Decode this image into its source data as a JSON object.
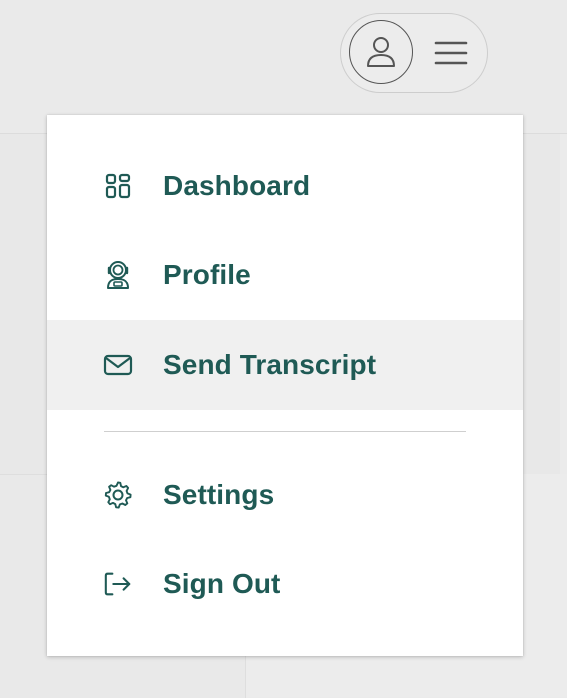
{
  "colors": {
    "accent": "#1f5a55",
    "highlight": "#f0f0f0",
    "background": "#ebebeb",
    "dropdown": "#ffffff"
  },
  "header": {
    "avatar_icon": "user-icon",
    "menu_icon": "hamburger-menu-icon"
  },
  "menu": {
    "items": [
      {
        "label": "Dashboard",
        "icon": "dashboard-grid-icon"
      },
      {
        "label": "Profile",
        "icon": "astronaut-icon"
      },
      {
        "label": "Send Transcript",
        "icon": "envelope-icon",
        "highlighted": true
      },
      {
        "label": "Settings",
        "icon": "gear-icon"
      },
      {
        "label": "Sign Out",
        "icon": "sign-out-icon"
      }
    ]
  }
}
